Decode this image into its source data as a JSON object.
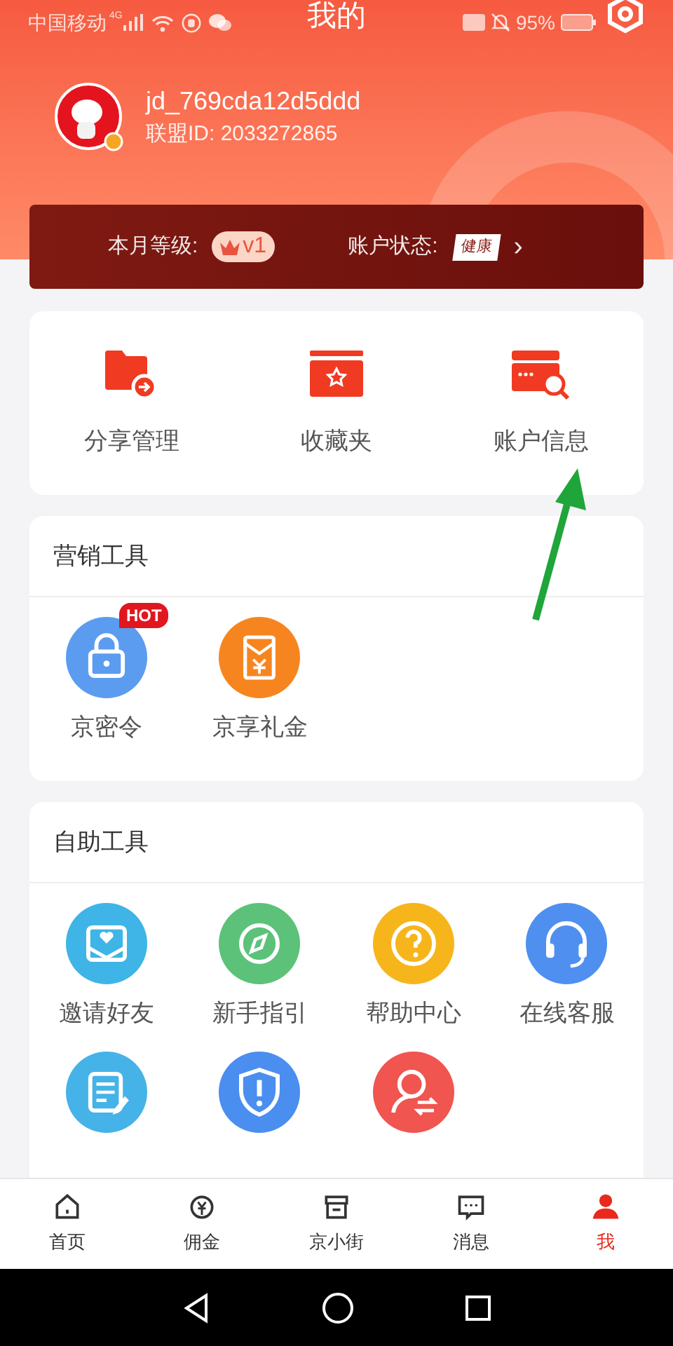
{
  "status_bar": {
    "carrier": "中国移动",
    "network": "4G",
    "battery": "95%"
  },
  "title": "我的",
  "profile": {
    "username": "jd_769cda12d5ddd",
    "union_id": "联盟ID: 2033272865"
  },
  "level_bar": {
    "level_label": "本月等级:",
    "level_badge": "v1",
    "status_label": "账户状态:",
    "status_badge": "健康",
    "chevron": "›"
  },
  "quick_actions": [
    {
      "label": "分享管理"
    },
    {
      "label": "收藏夹"
    },
    {
      "label": "账户信息"
    }
  ],
  "marketing": {
    "title": "营销工具",
    "items": [
      {
        "label": "京密令",
        "badge": "HOT",
        "color": "#5b9cf0"
      },
      {
        "label": "京享礼金",
        "color": "#f7851f"
      }
    ]
  },
  "self_service": {
    "title": "自助工具",
    "items": [
      {
        "label": "邀请好友",
        "color": "#3fb4e6"
      },
      {
        "label": "新手指引",
        "color": "#5cc27a"
      },
      {
        "label": "帮助中心",
        "color": "#f7b51c"
      },
      {
        "label": "在线客服",
        "color": "#4f8ff0"
      },
      {
        "color": "#45b3e8"
      },
      {
        "color": "#4a8ef0"
      },
      {
        "color": "#f0554f"
      }
    ]
  },
  "tab_bar": [
    {
      "label": "首页",
      "selected": false
    },
    {
      "label": "佣金",
      "selected": false
    },
    {
      "label": "京小街",
      "selected": false
    },
    {
      "label": "消息",
      "selected": false
    },
    {
      "label": "我",
      "selected": true
    }
  ]
}
